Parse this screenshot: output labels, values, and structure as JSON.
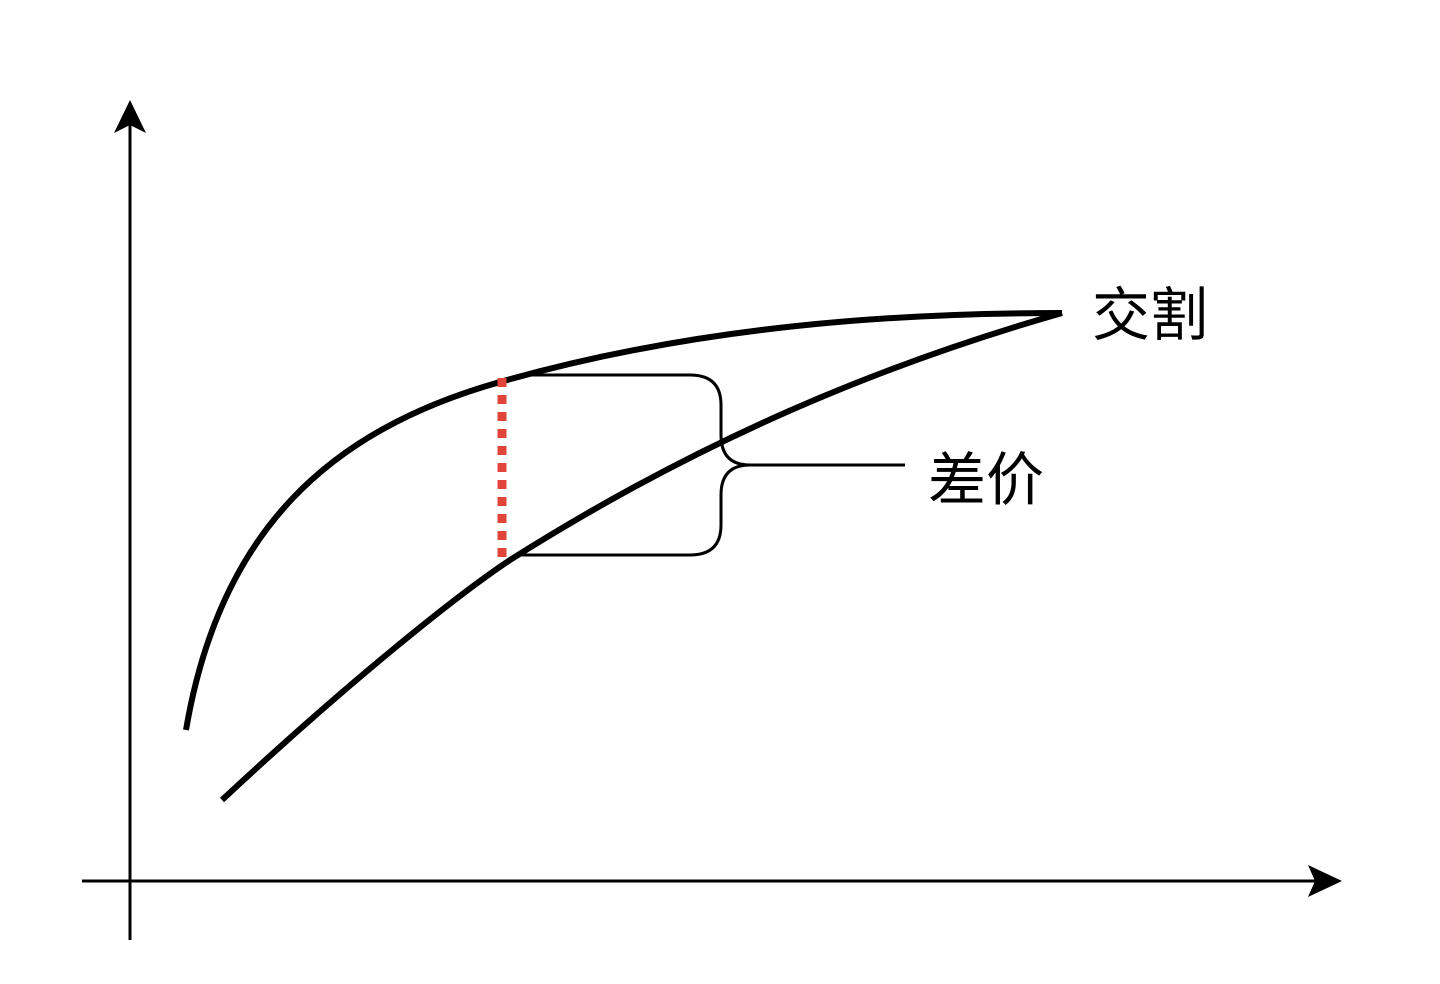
{
  "labels": {
    "delivery": "交割",
    "spread": "差价"
  },
  "colors": {
    "curve": "#000000",
    "axis": "#000000",
    "spread_marker": "#e0443a",
    "background": "#ffffff"
  }
}
